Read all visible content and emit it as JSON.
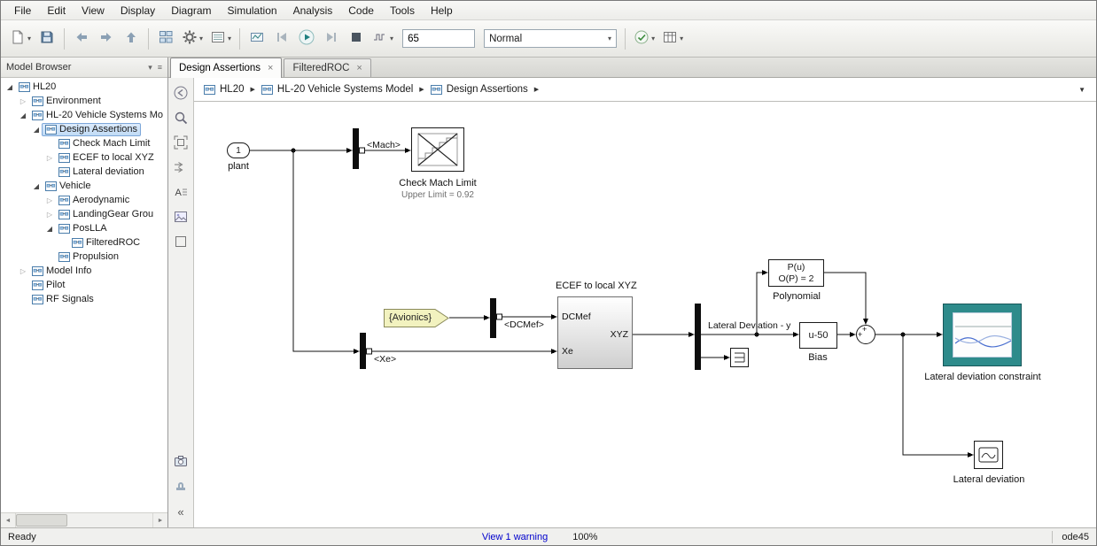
{
  "menubar": {
    "items": [
      "File",
      "Edit",
      "View",
      "Display",
      "Diagram",
      "Simulation",
      "Analysis",
      "Code",
      "Tools",
      "Help"
    ]
  },
  "toolbar": {
    "stop_time": "65",
    "mode": "Normal",
    "layout": [
      "new-model",
      "save",
      "|",
      "back",
      "forward",
      "up-to-parent",
      "|",
      "library-browser",
      "model-configuration",
      "model-explorer",
      "|",
      "stepping-options",
      "step-back",
      "run",
      "step-forward",
      "stop",
      "simulation-pacing",
      "input",
      "mode",
      "|",
      "update-diagram",
      "build"
    ],
    "dropdown_buttons": [
      "new-model",
      "model-configuration",
      "model-explorer",
      "simulation-pacing",
      "update-diagram",
      "build"
    ]
  },
  "model_browser": {
    "title": "Model Browser",
    "tree": [
      {
        "label": "HL20",
        "level": 0,
        "state": "exp"
      },
      {
        "label": "Environment",
        "level": 1,
        "state": "col"
      },
      {
        "label": "HL-20 Vehicle Systems Mo",
        "level": 1,
        "state": "exp"
      },
      {
        "label": "Design Assertions",
        "level": 2,
        "state": "exp",
        "selected": true
      },
      {
        "label": "Check Mach Limit",
        "level": 3,
        "state": "leaf"
      },
      {
        "label": "ECEF to local XYZ",
        "level": 3,
        "state": "col"
      },
      {
        "label": "Lateral deviation",
        "level": 3,
        "state": "leaf"
      },
      {
        "label": "Vehicle",
        "level": 2,
        "state": "exp"
      },
      {
        "label": "Aerodynamic",
        "level": 3,
        "state": "col"
      },
      {
        "label": "LandingGear Grou",
        "level": 3,
        "state": "col"
      },
      {
        "label": "PosLLA",
        "level": 3,
        "state": "exp"
      },
      {
        "label": "FilteredROC",
        "level": 4,
        "state": "leaf"
      },
      {
        "label": "Propulsion",
        "level": 3,
        "state": "leaf"
      },
      {
        "label": "Model Info",
        "level": 1,
        "state": "col"
      },
      {
        "label": "Pilot",
        "level": 1,
        "state": "leaf"
      },
      {
        "label": "RF Signals",
        "level": 1,
        "state": "leaf"
      }
    ]
  },
  "tabs": [
    {
      "label": "Design Assertions",
      "active": true
    },
    {
      "label": "FilteredROC",
      "active": false
    }
  ],
  "breadcrumb": {
    "items": [
      "HL20",
      "HL-20 Vehicle Systems Model",
      "Design Assertions"
    ]
  },
  "palette": {
    "buttons": [
      "explorer-bar-toggle",
      "zoom",
      "fit-to-view",
      "forward-arrows",
      "annotation",
      "image",
      "area",
      "spacer",
      "viewmark-camera",
      "stamp",
      "collapse"
    ]
  },
  "icons": {
    "dropdown": "▾",
    "crumb_sep": "▶",
    "close": "×",
    "collapse": "«",
    "scroll_left": "◄",
    "scroll_right": "►",
    "tree_expanded": "◢",
    "tree_collapsed": "▷",
    "browser_menu": "▾",
    "browser_lines": "≡",
    "breadcrumb_dropdown": "▼"
  },
  "diagram": {
    "inport": {
      "num": "1",
      "label": "plant"
    },
    "signals": {
      "mach": "<Mach>",
      "dcmef": "<DCMef>",
      "xe": "<Xe>",
      "lateral": "Lateral Deviation - y"
    },
    "tag": "{Avionics}",
    "check_mach": {
      "label": "Check Mach Limit",
      "sublabel": "Upper Limit = 0.92"
    },
    "ecef": {
      "title": "ECEF to local XYZ",
      "port_in1": "DCMef",
      "port_in2": "Xe",
      "port_out": "XYZ"
    },
    "polynomial": {
      "line1": "P(u)",
      "line2": "O(P) = 2",
      "label": "Polynomial"
    },
    "bias": {
      "text": "u-50",
      "label": "Bias"
    },
    "sum": {
      "sign_top": "+",
      "sign_left": "+"
    },
    "scope_constraint": {
      "label": "Lateral deviation constraint"
    },
    "scope": {
      "label": "Lateral deviation"
    }
  },
  "status": {
    "ready": "Ready",
    "warning_link": "View 1 warning",
    "zoom": "100%",
    "solver": "ode45"
  },
  "colors": {
    "accent_teal": "#2e8b8b",
    "selection": "#c1dbf5",
    "warning_link": "#0000cc",
    "tag_fill": "#f2f2bf"
  }
}
